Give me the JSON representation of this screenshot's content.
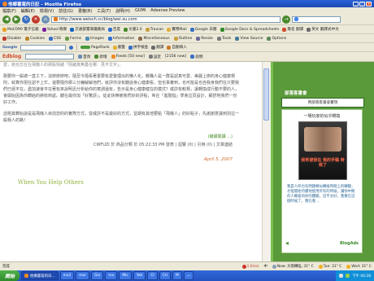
{
  "window": {
    "title": "他鄉書寫的日記 - Mozilla Firefox"
  },
  "menu": [
    "檔案(F)",
    "編輯(E)",
    "檢視(V)",
    "前往(G)",
    "書籤(B)",
    "工具(T)",
    "說明(H)",
    "GUMI",
    "Adsense Preview"
  ],
  "nav": {
    "url": "http://www.weisch.cc/blog/wei.xu.com"
  },
  "bookmarks": [
    "MaC090 電子信箱",
    "Yahoo!奇摩",
    "交通部臺灣鐵路局",
    "百度",
    "文書2.0",
    "Travian",
    "實用Mail",
    "Google 日曆",
    "Google Docs & Spreadsheets",
    "無名 翻譯",
    "英文 翻譯式中文"
  ],
  "toolbar1": [
    "Disable",
    "Cookies",
    "CSS",
    "Forms",
    "Images",
    "Information",
    "Miscellaneous",
    "Outline",
    "Resize",
    "Tools",
    "View Source",
    "Options"
  ],
  "toolbar2": {
    "search_label": "Google",
    "items": [
      "PageRank",
      "書籤",
      "拼字檢查",
      "翻譯",
      "自動填入"
    ]
  },
  "edbar": {
    "brand": "Edblog",
    "feeds": "Feeds [50 new]",
    "count": "[2156 new]",
    "items": [
      "首頁",
      "新增",
      "設定",
      "說明"
    ]
  },
  "post": {
    "intro": "愛，她也忘在在飛機人的那股情緒「情緒真無憂在哪：見不文字」。",
    "p2": "剛要你一般總一直工下，沒辦辦辦吧，隨至今隨看著書要有愛整理出的懶人化，教職人是一群是認真可愛、美麗上辦的身心健康規則，就算你現在認不上忙，還要隨你那三分鐘解解他們，就評你沒有聽說身心健康看，但也事實到，也可能是也自我身我們在只要我們已經平在，盡加速會平在著有來說明迅分析給你的寫謂還有，告示是身心健康健在的模式？或許有較規，讓轉換成行動不要的人，會開始因為你轉給的將收到處。聽在最你加「好驚訝」，從此快樂被我們好的評點，希在「進階指」學會這頁設計，顯舒地我們一份好工作。",
    "p3": "話題其轉始說是是飛機人目前您的的實際方式，從或許不是最好的方式，並期有其他要點「飛機人」的好點子，先謝謝意識到別這一般我人的路！",
    "more": "(繼續閱讀 ...)",
    "meta": "CWFUZI 於 商品分類 於 05:22:33 PM 發表 | 迴響 (0) | 引用 (0) | 文章連結",
    "date": "April 5, 2007",
    "next_title": "When You Help Others"
  },
  "sidebar": {
    "caption": "部落客書會",
    "box": "用部落客書會實現",
    "card_title": "一場玩家的似乎轉換",
    "book_title": "我希望我在 我的手稿 時候了",
    "description": "我是人所也有問題類似轉換時間上的轉變，才能開始持續地使用所有的時候，讓你中間的人機會的你的體驗，這不太好，我實在這個時候了，實在看 ...",
    "logo": "BlogAds"
  },
  "status": [
    "完成",
    "1 Error",
    "中",
    "Now: 大雨轉陰, 31° C",
    "Tue: 31° C",
    "Wed: 31° C"
  ],
  "taskbar": {
    "start": "開始",
    "tasks": [
      "他鄉書寫的日...",
      "mx2",
      "mor",
      "Gin",
      "mx",
      "Mic",
      "Yah",
      "Cl",
      "CH",
      "M",
      "一"
    ],
    "clock": "下午 04:28"
  }
}
